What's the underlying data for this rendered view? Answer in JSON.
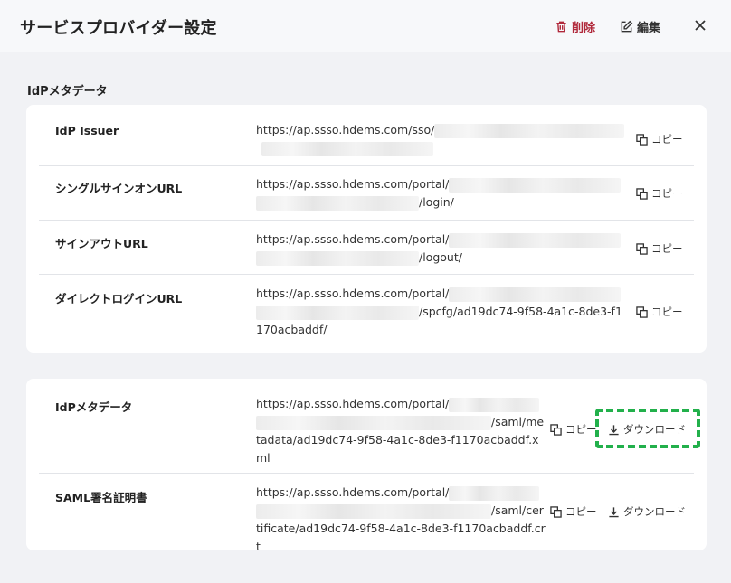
{
  "header": {
    "title": "サービスプロバイダー設定",
    "delete_label": "削除",
    "edit_label": "編集"
  },
  "idp_section": {
    "label": "IdPメタデータ",
    "rows": [
      {
        "label": "IdP Issuer",
        "value_prefix": "https://ap.ssso.hdems.com/sso/",
        "value_suffix": ""
      },
      {
        "label": "シングルサインオンURL",
        "value_prefix": "https://ap.ssso.hdems.com/portal/",
        "value_suffix": "/login/"
      },
      {
        "label": "サインアウトURL",
        "value_prefix": "https://ap.ssso.hdems.com/portal/",
        "value_suffix": "/logout/"
      },
      {
        "label": "ダイレクトログインURL",
        "value_prefix": "https://ap.ssso.hdems.com/portal/",
        "value_suffix": "/spcfg/ad19dc74-9f58-4a1c-8de3-f1170acbaddf/"
      }
    ]
  },
  "metadata_section": {
    "rows": [
      {
        "label": "IdPメタデータ",
        "value_prefix": "https://ap.ssso.hdems.com/portal/",
        "value_suffix": "/saml/metadata/ad19dc74-9f58-4a1c-8de3-f1170acbaddf.xml"
      },
      {
        "label": "SAML署名証明書",
        "value_prefix": "https://ap.ssso.hdems.com/portal/",
        "value_suffix": "/saml/certificate/ad19dc74-9f58-4a1c-8de3-f1170acbaddf.crt"
      }
    ]
  },
  "actions": {
    "copy_label": "コピー",
    "download_label": "ダウンロード"
  },
  "colors": {
    "delete": "#b0283a",
    "highlight": "#22b04b"
  }
}
